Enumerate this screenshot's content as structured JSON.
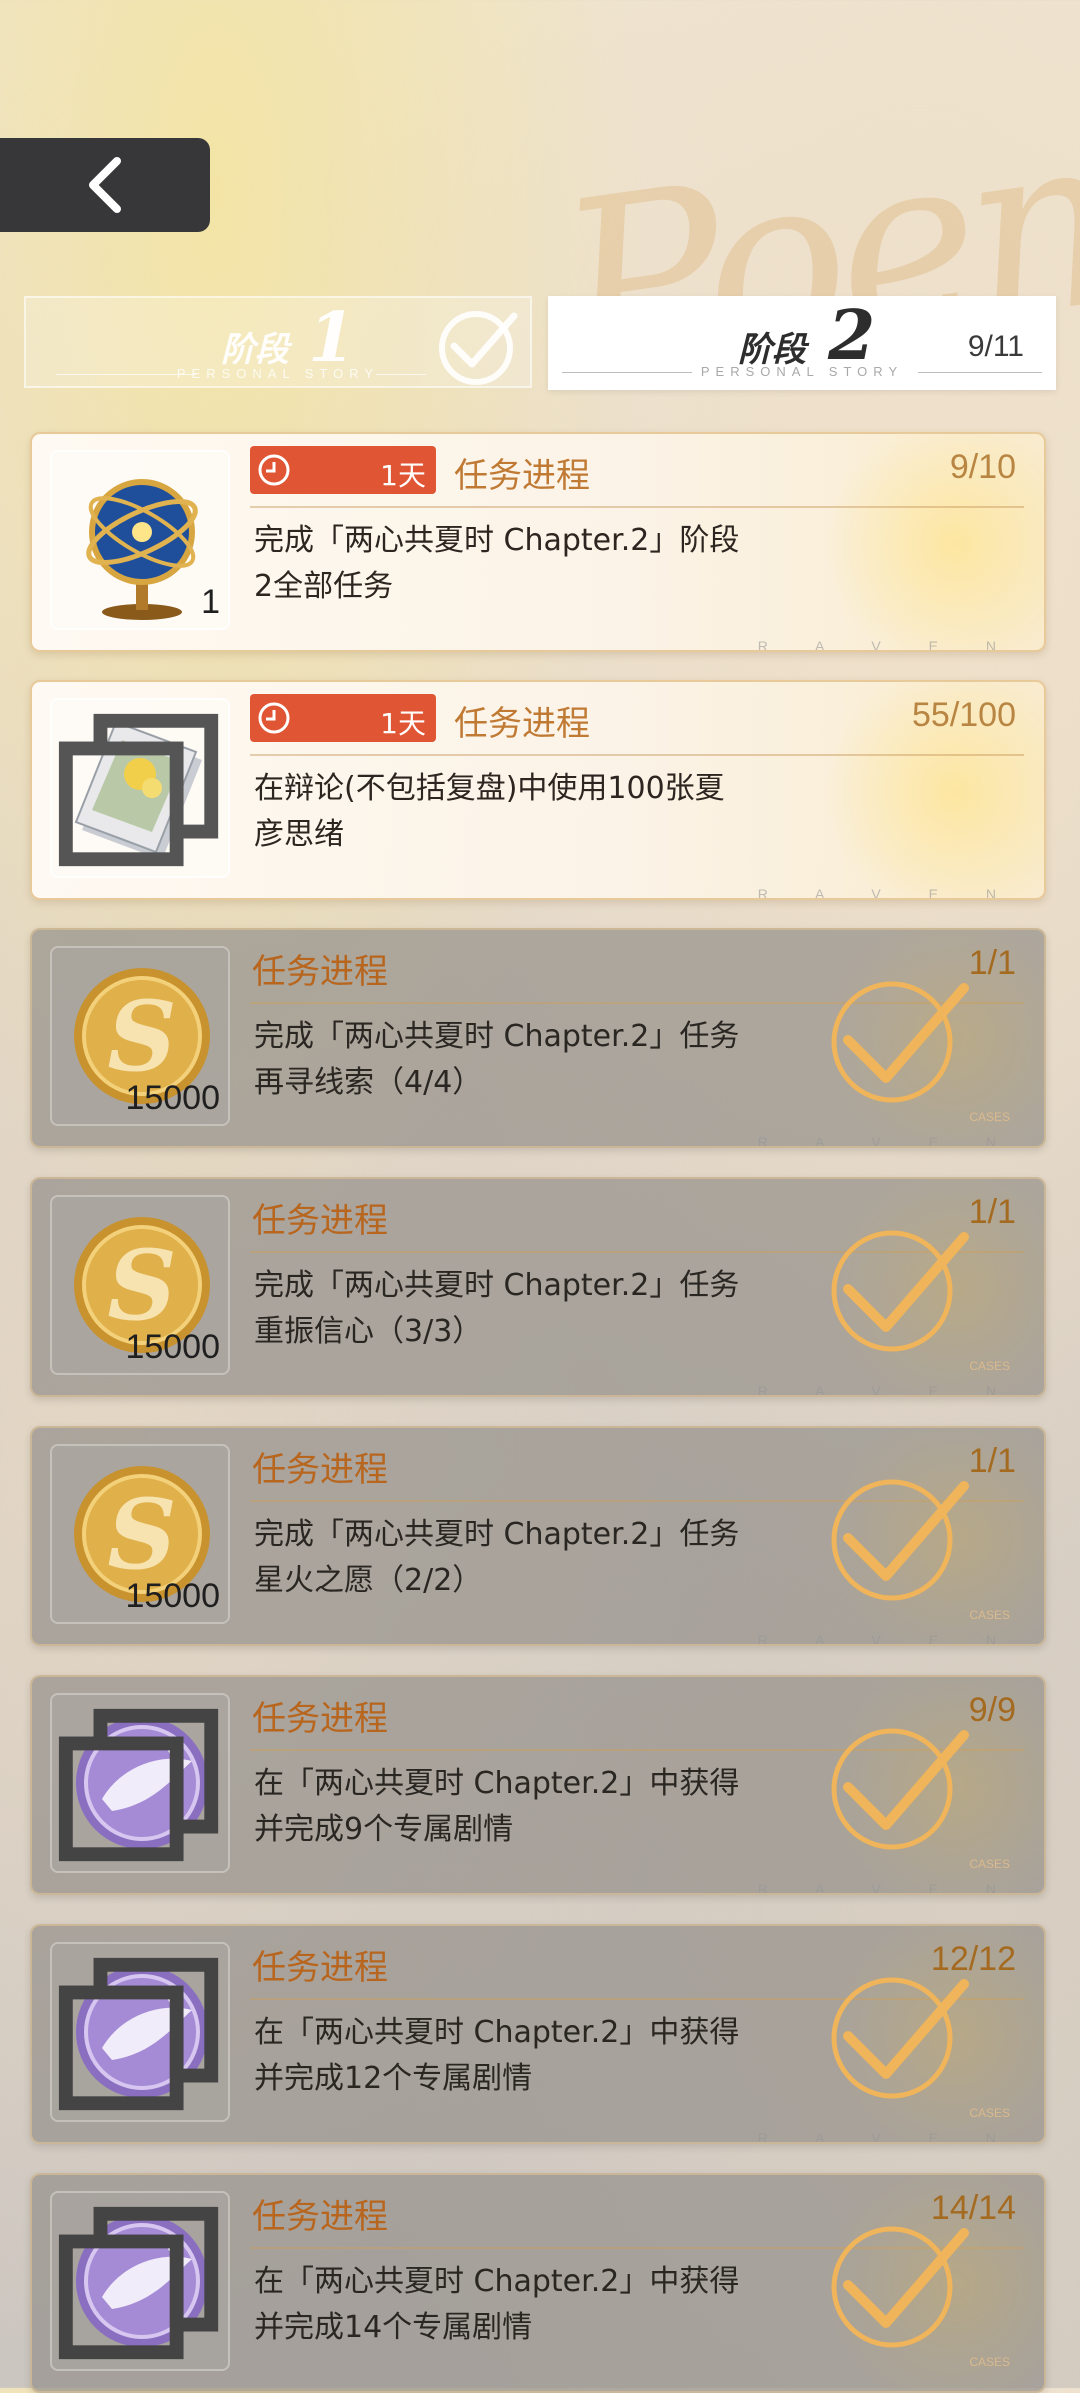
{
  "nav": {
    "back_icon": "chevron-left-icon"
  },
  "decor": {
    "script_text": "Poem"
  },
  "stages": [
    {
      "label": "阶段",
      "number": "1",
      "subtitle": "PERSONAL STORY",
      "completed": true
    },
    {
      "label": "阶段",
      "number": "2",
      "subtitle": "PERSONAL STORY",
      "progress": "9/11"
    }
  ],
  "footer_word": "R A V E N",
  "cases_word": "CASES",
  "tasks": [
    {
      "timer": "1天",
      "title": "任务进程",
      "progress": "9/10",
      "desc_line1": "完成「两心共夏时 Chapter.2」阶段",
      "desc_line2": "2全部任务",
      "reward_icon": "armillary-globe-icon",
      "reward_count": "1",
      "status": "active"
    },
    {
      "timer": "1天",
      "title": "任务进程",
      "progress": "55/100",
      "desc_line1": "在辩论(不包括复盘)中使用100张夏",
      "desc_line2": "彦思绪",
      "reward_icon": "card-book-icon",
      "reward_count": "",
      "status": "active"
    },
    {
      "title": "任务进程",
      "progress": "1/1",
      "desc_line1": "完成「两心共夏时 Chapter.2」任务",
      "desc_line2": "再寻线索（4/4）",
      "reward_icon": "gold-coin-icon",
      "reward_count": "15000",
      "status": "done"
    },
    {
      "title": "任务进程",
      "progress": "1/1",
      "desc_line1": "完成「两心共夏时 Chapter.2」任务",
      "desc_line2": "重振信心（3/3）",
      "reward_icon": "gold-coin-icon",
      "reward_count": "15000",
      "status": "done"
    },
    {
      "title": "任务进程",
      "progress": "1/1",
      "desc_line1": "完成「两心共夏时 Chapter.2」任务",
      "desc_line2": "星火之愿（2/2）",
      "reward_icon": "gold-coin-icon",
      "reward_count": "15000",
      "status": "done"
    },
    {
      "title": "任务进程",
      "progress": "9/9",
      "desc_line1": "在「两心共夏时 Chapter.2」中获得",
      "desc_line2": "并完成9个专属剧情",
      "reward_icon": "purple-emblem-icon",
      "reward_count": "",
      "status": "done"
    },
    {
      "title": "任务进程",
      "progress": "12/12",
      "desc_line1": "在「两心共夏时 Chapter.2」中获得",
      "desc_line2": "并完成12个专属剧情",
      "reward_icon": "purple-emblem-icon",
      "reward_count": "",
      "status": "done"
    },
    {
      "title": "任务进程",
      "progress": "14/14",
      "desc_line1": "在「两心共夏时 Chapter.2」中获得",
      "desc_line2": "并完成14个专属剧情",
      "reward_icon": "purple-emblem-icon",
      "reward_count": "",
      "status": "done"
    }
  ],
  "colors": {
    "timer_badge": "#e05533",
    "accent_text": "#c07a34",
    "check": "#f0b45a",
    "back_button": "#37373a"
  }
}
